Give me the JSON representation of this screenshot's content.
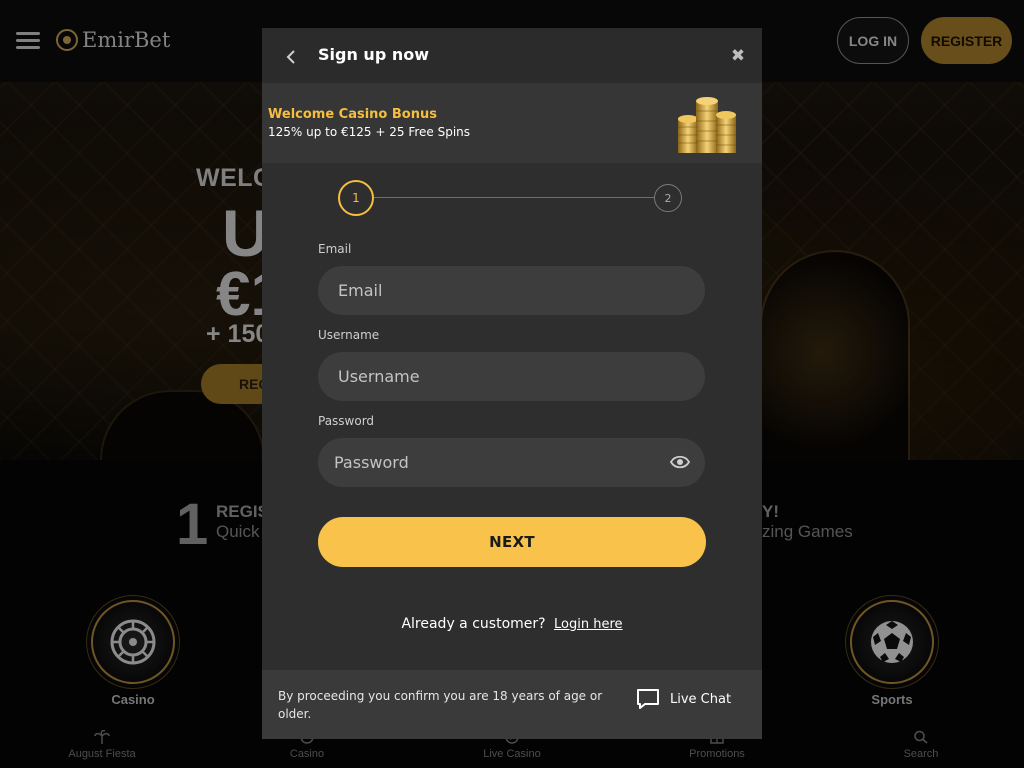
{
  "header": {
    "logo_text": "EmirBet",
    "login_label": "LOG IN",
    "register_label": "REGISTER"
  },
  "hero": {
    "welcome_text": "WELCO",
    "headline_1": "U",
    "headline_2": "€1",
    "sub_text": "+ 150",
    "button_label": "REG"
  },
  "steps_section": {
    "number": "1",
    "title": "REGIS",
    "desc": "Quick",
    "right_title": "Y!",
    "right_desc": "zing Games"
  },
  "categories": [
    {
      "label": "Casino",
      "icon": "roulette-icon"
    },
    {
      "label": "Sports",
      "icon": "soccer-ball-icon"
    }
  ],
  "bottom_nav": [
    {
      "label": "August Fiesta",
      "icon": "palm-icon"
    },
    {
      "label": "Casino",
      "icon": "casino-icon"
    },
    {
      "label": "Live Casino",
      "icon": "live-casino-icon"
    },
    {
      "label": "Promotions",
      "icon": "promotions-icon"
    },
    {
      "label": "Search",
      "icon": "search-icon"
    }
  ],
  "modal": {
    "title": "Sign up now",
    "bonus": {
      "title": "Welcome Casino Bonus",
      "desc": "125% up to €125 + 25 Free Spins"
    },
    "stepper": {
      "step1": "1",
      "step2": "2",
      "current_step": 1
    },
    "email": {
      "label": "Email",
      "placeholder": "Email",
      "value": ""
    },
    "username": {
      "label": "Username",
      "placeholder": "Username",
      "value": ""
    },
    "password": {
      "label": "Password",
      "placeholder": "Password",
      "value": ""
    },
    "next_label": "NEXT",
    "already_text": "Already a customer?",
    "login_link": "Login here",
    "footer_text": "By proceeding you confirm you are 18 years of age or older.",
    "live_chat_label": "Live Chat"
  },
  "colors": {
    "accent": "#f9c24a",
    "bonus_title": "#f5be3f",
    "register_bg": "#a87f2b",
    "modal_bg": "#2e2e2e"
  }
}
